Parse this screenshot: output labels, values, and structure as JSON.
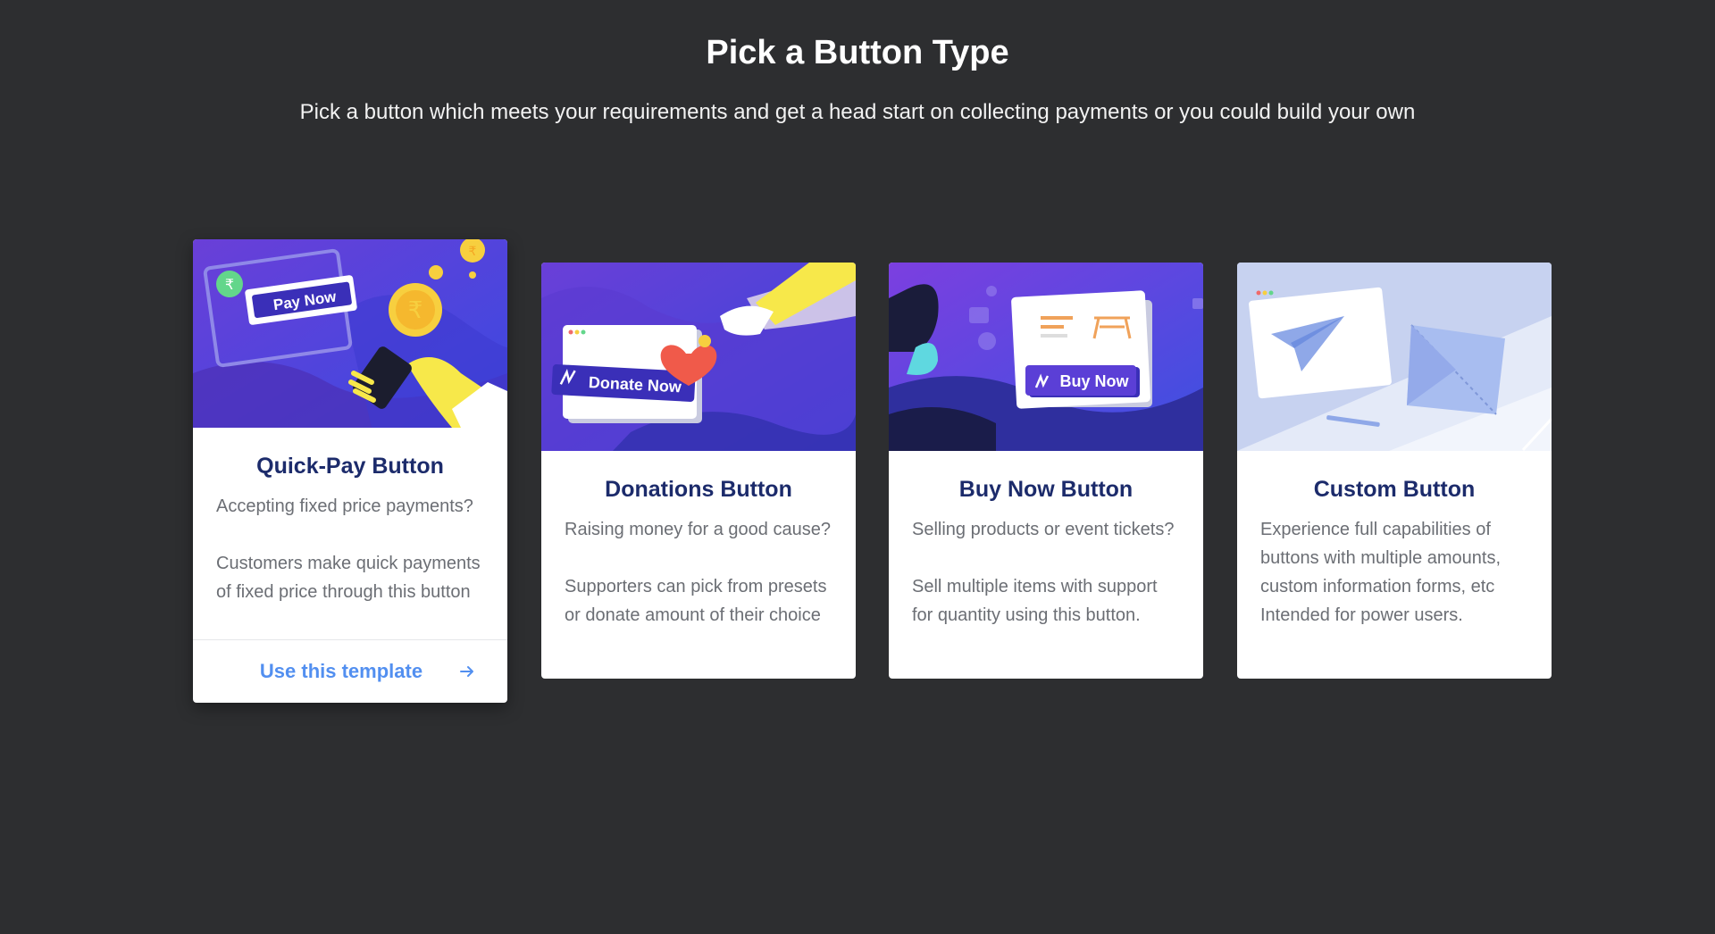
{
  "header": {
    "title": "Pick a Button Type",
    "subtitle": "Pick a button which meets your requirements and get a head start on collecting payments or you could build your own"
  },
  "cards": [
    {
      "title": "Quick-Pay Button",
      "line1": "Accepting fixed price payments?",
      "line2": "Customers make quick payments of fixed price through this button",
      "illustration_label": "Pay Now",
      "illustration_icon": "rupee-icon",
      "footer_label": "Use this template",
      "hovered": true
    },
    {
      "title": "Donations Button",
      "line1": "Raising money for a good cause?",
      "line2": "Supporters can pick from presets or donate amount of their choice",
      "illustration_label": "Donate Now",
      "illustration_icon": "heart-icon"
    },
    {
      "title": "Buy Now Button",
      "line1": "Selling products or event tickets?",
      "line2": "Sell multiple items with support for quantity using this button.",
      "illustration_label": "Buy Now",
      "illustration_icon": "cart-icon"
    },
    {
      "title": "Custom Button",
      "line1": "Experience full capabilities of buttons with multiple amounts, custom information forms, etc Intended for power users.",
      "illustration_icon": "paper-plane-icon"
    }
  ],
  "colors": {
    "background": "#2d2e30",
    "card_title": "#1c2b6b",
    "link": "#528ff0",
    "illustration_purple": "#5b3fd6",
    "illustration_yellow": "#f7cf3f"
  }
}
